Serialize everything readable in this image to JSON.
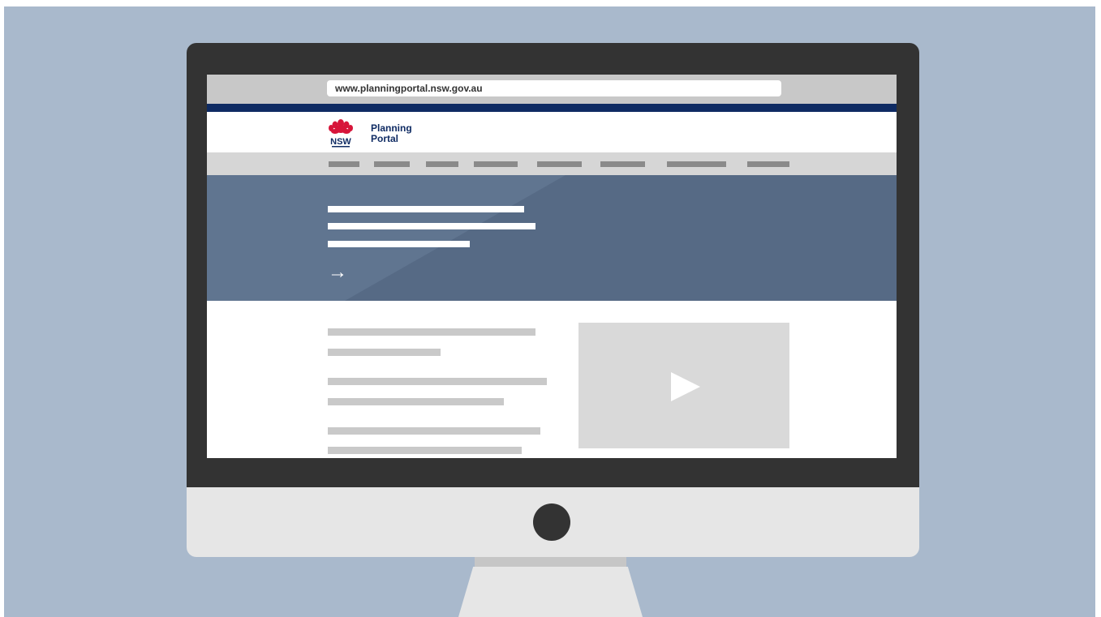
{
  "browser": {
    "url": "www.planningportal.nsw.gov.au"
  },
  "header": {
    "logo_mark": "NSW",
    "logo_line1": "Planning",
    "logo_line2": "Portal"
  },
  "colors": {
    "navy_strip": "#0f2b63",
    "hero": "#566a85",
    "background": "#a9b9cc",
    "bezel": "#333333",
    "waratah_red": "#d7153a"
  },
  "icons": {
    "hero_arrow": "right-arrow-icon",
    "video": "play-icon"
  },
  "hero": {
    "arrow": "→"
  }
}
